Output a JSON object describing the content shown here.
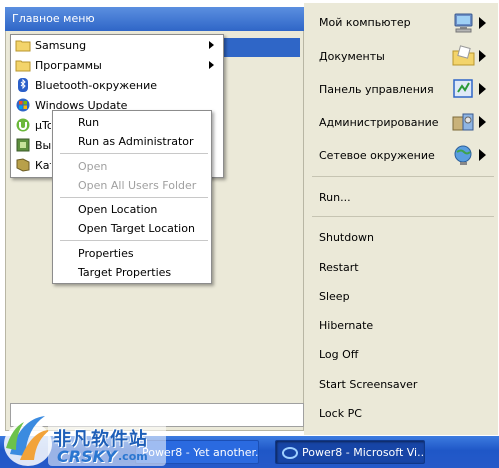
{
  "left_panel": {
    "header": "Главное меню"
  },
  "main_menu": {
    "items": [
      {
        "label": "Samsung",
        "icon": "folder-icon",
        "has_submenu": true
      },
      {
        "label": "Программы",
        "icon": "folder-icon",
        "has_submenu": true
      },
      {
        "label": "Bluetooth-окружение",
        "icon": "bluetooth-icon",
        "has_submenu": false
      },
      {
        "label": "Windows Update",
        "icon": "windows-update-icon",
        "has_submenu": false
      },
      {
        "label": "µTo",
        "icon": "utorrent-icon",
        "has_submenu": false
      },
      {
        "label": "Вы",
        "icon": "app-icon",
        "has_submenu": false
      },
      {
        "label": "Кат",
        "icon": "catalog-icon",
        "has_submenu": false
      }
    ]
  },
  "context_menu": {
    "items": [
      {
        "label": "Run",
        "enabled": true
      },
      {
        "label": "Run as Administrator",
        "enabled": true
      },
      {
        "label": "Open",
        "enabled": false
      },
      {
        "label": "Open All Users Folder",
        "enabled": false
      },
      {
        "label": "Open Location",
        "enabled": true
      },
      {
        "label": "Open Target Location",
        "enabled": true
      },
      {
        "label": "Properties",
        "enabled": true
      },
      {
        "label": "Target Properties",
        "enabled": true
      }
    ]
  },
  "right_panel": {
    "places": [
      {
        "label": "Мой компьютер",
        "icon": "my-computer-icon"
      },
      {
        "label": "Документы",
        "icon": "documents-folder-icon"
      },
      {
        "label": "Панель управления",
        "icon": "control-panel-icon"
      },
      {
        "label": "Администрирование",
        "icon": "administration-icon"
      },
      {
        "label": "Сетевое окружение",
        "icon": "network-icon"
      }
    ],
    "run_label": "Run...",
    "power_items": [
      "Shutdown",
      "Restart",
      "Sleep",
      "Hibernate",
      "Log Off",
      "Start Screensaver",
      "Lock PC"
    ]
  },
  "taskbar": {
    "items": [
      {
        "label": "Power8 - Yet another...",
        "active": false
      },
      {
        "label": "Power8 - Microsoft Vi...",
        "active": true
      }
    ]
  },
  "watermark": {
    "line1": "非凡软件站",
    "line2": "CRSKY",
    "line3": ".com"
  },
  "colors": {
    "panel": "#ebe9d8",
    "header_blue": "#2f66c7",
    "taskbar_blue": "#2559c9"
  }
}
